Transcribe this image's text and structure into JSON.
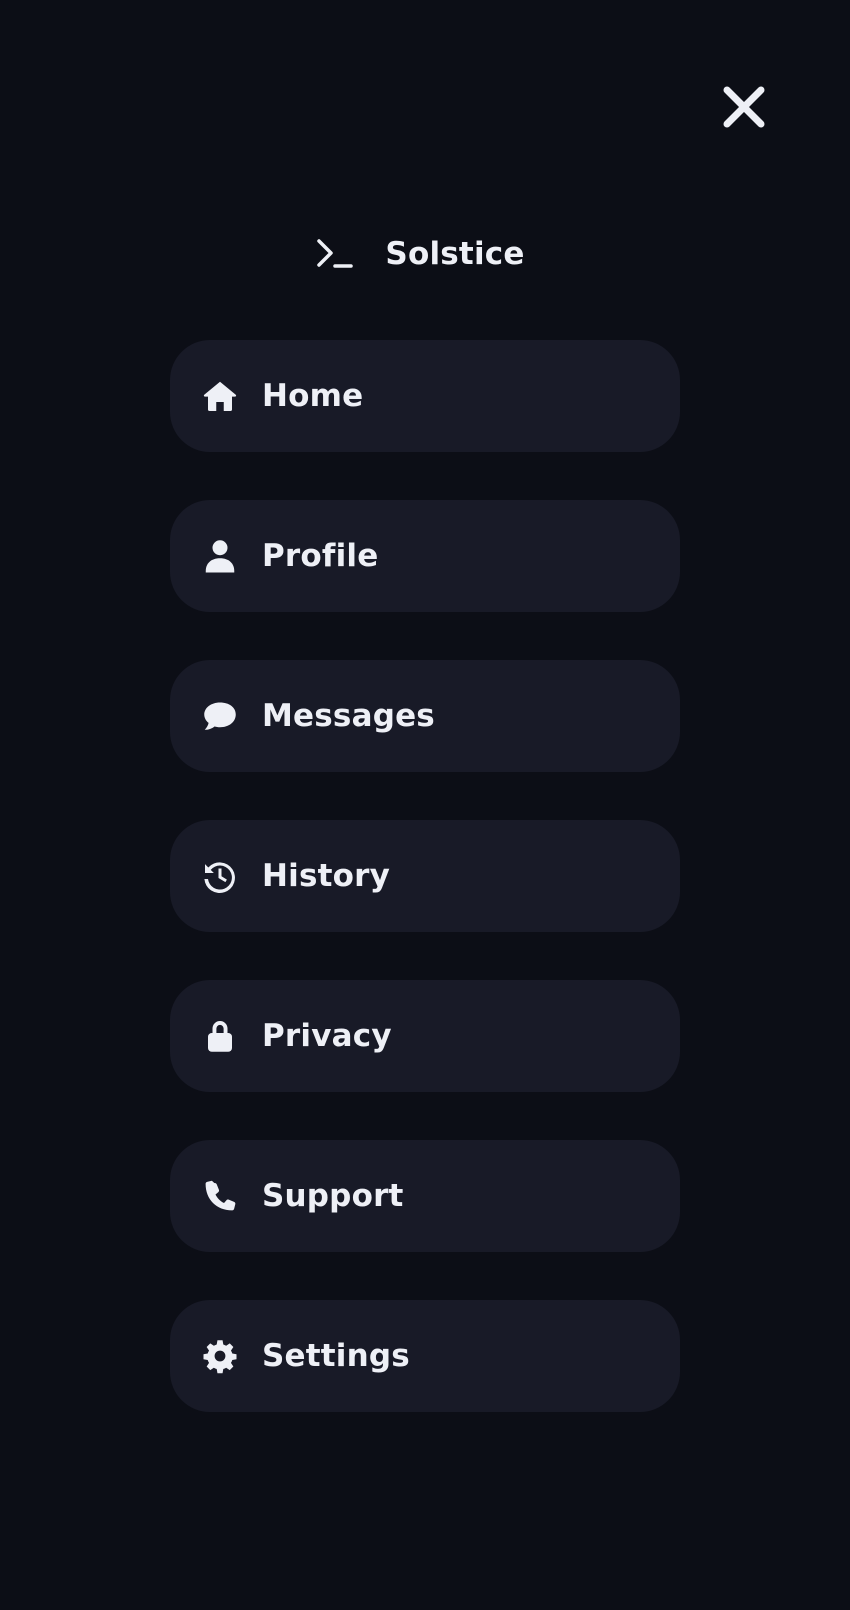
{
  "header": {
    "close_icon": "close-icon",
    "brand_icon": "terminal-icon",
    "brand_name": "Solstice"
  },
  "colors": {
    "background": "#0c0e16",
    "item_background": "#181a27",
    "text": "#eef0f6"
  },
  "menu": {
    "items": [
      {
        "label": "Home",
        "icon": "home-icon"
      },
      {
        "label": "Profile",
        "icon": "user-icon"
      },
      {
        "label": "Messages",
        "icon": "chat-bubble-icon"
      },
      {
        "label": "History",
        "icon": "history-icon"
      },
      {
        "label": "Privacy",
        "icon": "lock-icon"
      },
      {
        "label": "Support",
        "icon": "phone-icon"
      },
      {
        "label": "Settings",
        "icon": "gear-icon"
      }
    ]
  }
}
